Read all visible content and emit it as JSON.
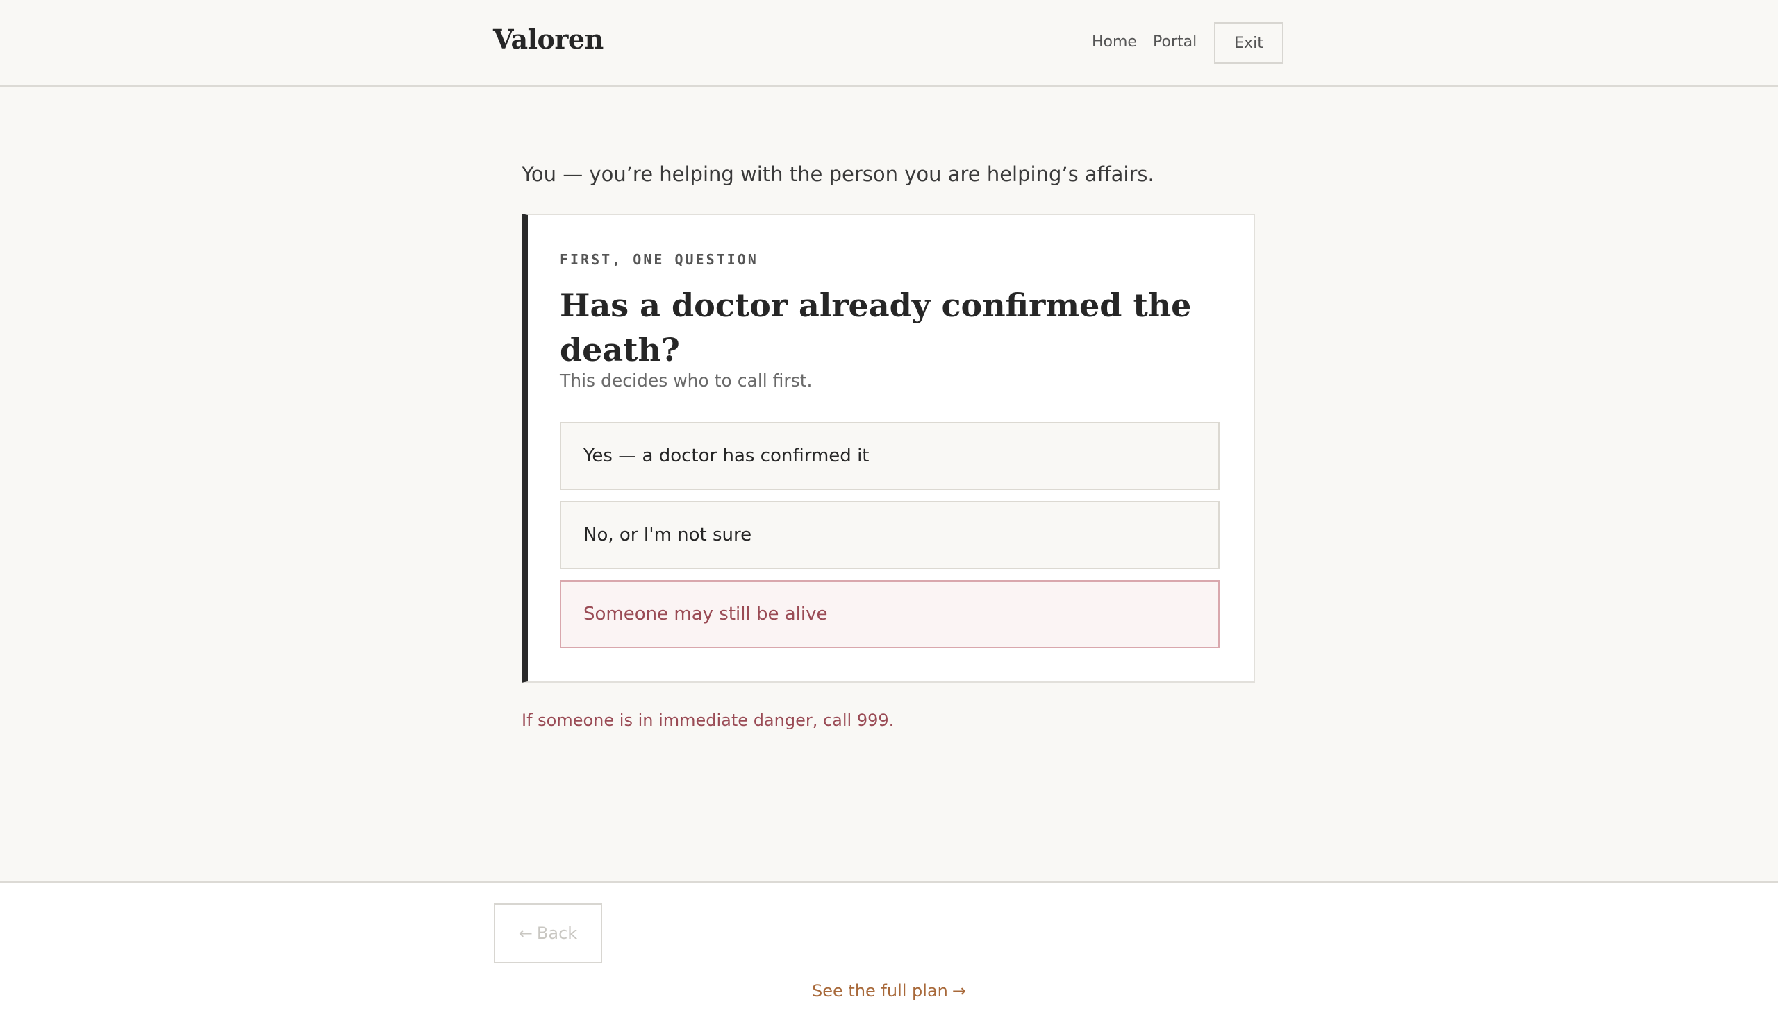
{
  "header": {
    "brand": "Valoren",
    "nav": {
      "home_label": "Home",
      "portal_label": "Portal"
    },
    "exit_label": "Exit"
  },
  "main": {
    "context_line": "You — you’re helping with the person you are helping’s affairs.",
    "card": {
      "eyebrow": "FIRST, ONE QUESTION",
      "question": "Has a doctor already confirmed the death?",
      "subtext": "This decides who to call first.",
      "options": [
        {
          "label": "Yes — a doctor has confirmed it"
        },
        {
          "label": "No, or I'm not sure"
        },
        {
          "label": "Someone may still be alive"
        }
      ]
    },
    "danger_note": "If someone is in immediate danger, call 999."
  },
  "footer": {
    "back_arrow": "←",
    "back_label": "Back",
    "full_plan_label": "See the full plan",
    "full_plan_arrow": "→"
  },
  "colors": {
    "background": "#f9f8f5",
    "accent_dark": "#2a2a2a",
    "alert": "#9a4b55",
    "link": "#a8693a"
  }
}
